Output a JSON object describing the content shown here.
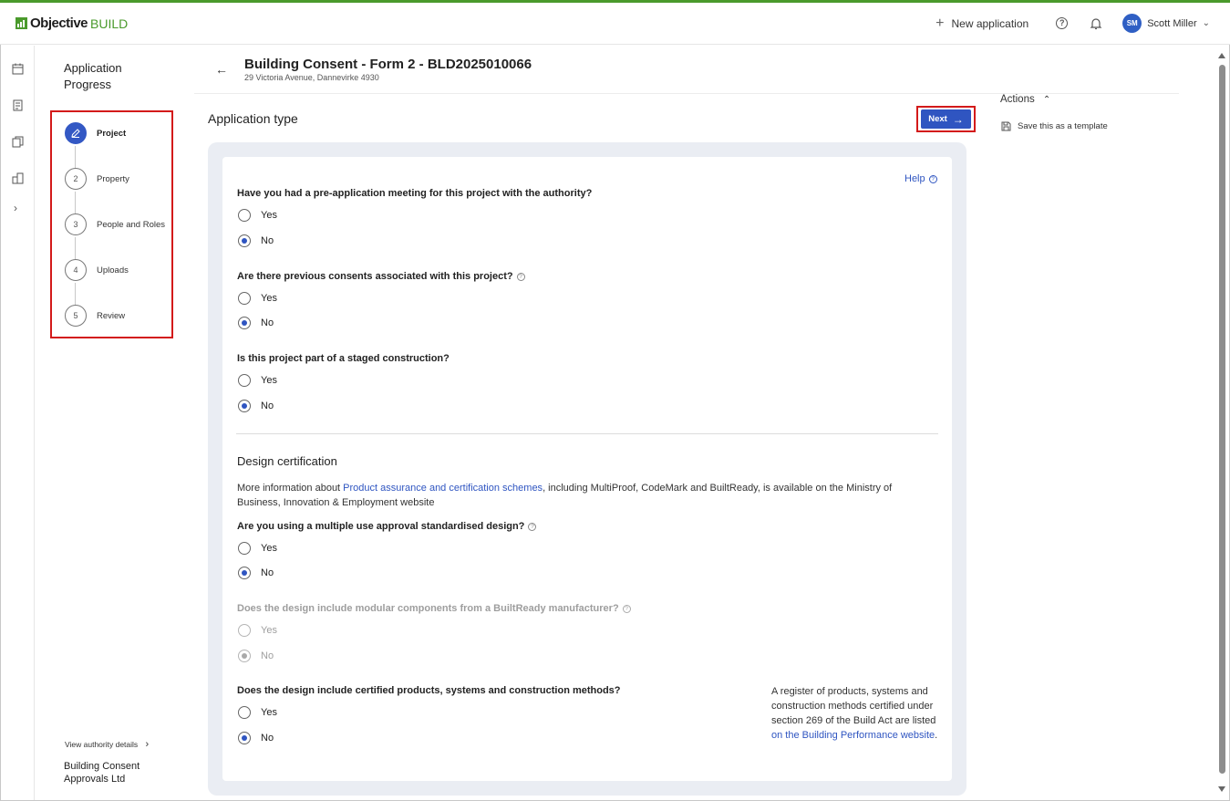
{
  "app": {
    "logo_bold": "Objective",
    "logo_light": "BUILD"
  },
  "topbar": {
    "new_application": "New application",
    "user_initials": "SM",
    "user_name": "Scott Miller"
  },
  "progress": {
    "title_line1": "Application",
    "title_line2": "Progress",
    "steps": [
      {
        "num": "",
        "label": "Project",
        "active": true
      },
      {
        "num": "2",
        "label": "Property"
      },
      {
        "num": "3",
        "label": "People and Roles"
      },
      {
        "num": "4",
        "label": "Uploads"
      },
      {
        "num": "5",
        "label": "Review"
      }
    ],
    "view_authority": "View authority details",
    "authority_line1": "Building Consent",
    "authority_line2": "Approvals Ltd"
  },
  "header": {
    "title": "Building Consent - Form 2 - BLD2025010066",
    "subtitle": "29 Victoria Avenue, Dannevirke 4930"
  },
  "section": {
    "title": "Application type",
    "next_label": "Next"
  },
  "actions": {
    "heading": "Actions",
    "save_template": "Save this as a template"
  },
  "form": {
    "help": "Help",
    "yes": "Yes",
    "no": "No",
    "q1": "Have you had a pre-application meeting for this project with the authority?",
    "q2": "Are there previous consents associated with this project?",
    "q3": "Is this project part of a staged construction?",
    "design_heading": "Design certification",
    "info_pre": "More information about ",
    "info_link": "Product assurance and certification schemes",
    "info_post": ", including MultiProof, CodeMark and BuiltReady, is available on the Ministry of Business, Innovation & Employment website",
    "q4": "Are you using a multiple use approval standardised design?",
    "q5": "Does the design include modular components from a BuiltReady manufacturer?",
    "q6": "Does the design include certified products, systems and construction methods?",
    "note_pre": "A register of products, systems and construction methods certified under section 269 of the Build Act are listed ",
    "note_link": "on the Building Performance website",
    "note_post": "."
  }
}
